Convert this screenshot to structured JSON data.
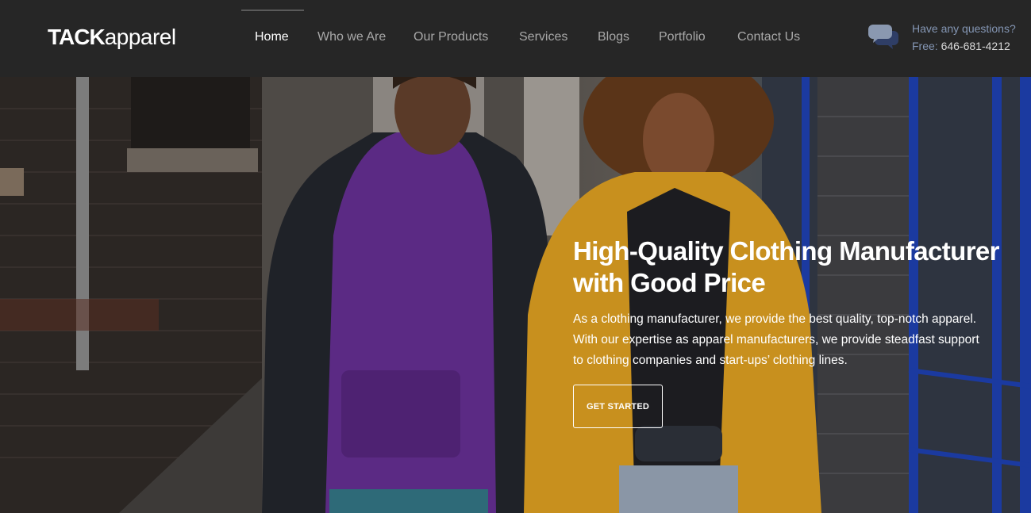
{
  "header": {
    "logo": {
      "bold": "TACK",
      "light": "apparel"
    },
    "nav": [
      {
        "label": "Home",
        "active": true
      },
      {
        "label": "Who we Are",
        "active": false
      },
      {
        "label": "Our Products",
        "active": false
      },
      {
        "label": "Services",
        "active": false
      },
      {
        "label": "Blogs",
        "active": false
      },
      {
        "label": "Portfolio",
        "active": false
      },
      {
        "label": "Contact Us",
        "active": false
      }
    ],
    "contact": {
      "question": "Have any questions?",
      "free_label": "Free:",
      "phone": "646-681-4212",
      "icon": "chat-bubbles-icon"
    }
  },
  "hero": {
    "title_line1": "High-Quality Clothing Manufacturer",
    "title_line2": "with Good Price",
    "desc_line1": "As a clothing manufacturer, we provide the best quality, top-notch apparel.",
    "desc_line2": "With our expertise as apparel manufacturers, we provide steadfast support",
    "desc_line3": "to clothing companies and start-ups’ clothing lines.",
    "cta_label": "GET STARTED"
  },
  "colors": {
    "header_bg": "#262626",
    "nav_inactive": "#a8a8a8",
    "nav_active": "#ffffff",
    "contact_accent": "#8496b4"
  }
}
